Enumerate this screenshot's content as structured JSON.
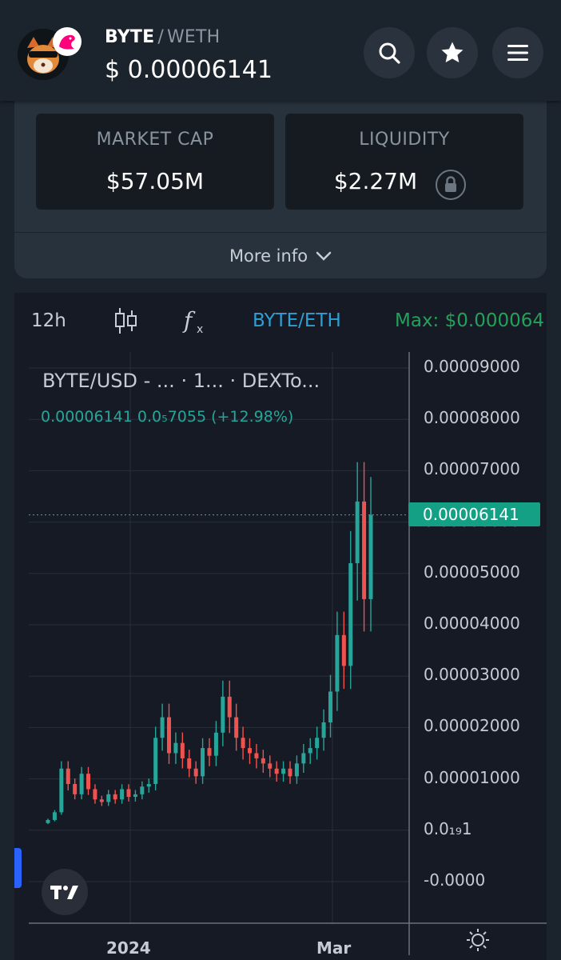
{
  "header": {
    "base_token": "BYTE",
    "separator": "/",
    "quote_token": "WETH",
    "price": "$  0.00006141",
    "icons": [
      "search-icon",
      "star-icon",
      "menu-icon"
    ]
  },
  "stats": {
    "market_cap_label": "MARKET CAP",
    "market_cap_value": "$57.05M",
    "liquidity_label": "LIQUIDITY",
    "liquidity_value": "$2.27M",
    "more_info_label": "More info"
  },
  "chart_toolbar": {
    "interval": "12h",
    "pair_label": "BYTE/ETH",
    "max_label": "Max: $0.000064"
  },
  "chart": {
    "title": "BYTE/USD - ...   · 1...   · DEXTo...",
    "ohlc_line": "0.00006141  0.0₅7055 (+12.98%)",
    "last_price_tag": "0.00006141",
    "colors": {
      "up": "#26a69a",
      "down": "#ef5350",
      "accent": "#2962ff"
    }
  },
  "chart_data": {
    "type": "candlestick",
    "y_tick_labels": [
      "0.00009000",
      "0.00008000",
      "0.00007000",
      "0.00006000",
      "0.00005000",
      "0.00004000",
      "0.00003000",
      "0.00002000",
      "0.00001000",
      "0.0₁₉1",
      "-0.0000"
    ],
    "x_tick_labels": [
      "2024",
      "Mar"
    ],
    "ylim": [
      0,
      9e-05
    ],
    "last_price": 6.141e-05,
    "change": "+12.98%",
    "closes": [
      2e-06,
      3.5e-06,
      1.2e-05,
      9e-06,
      7e-06,
      1.1e-05,
      8e-06,
      6e-06,
      5.5e-06,
      7e-06,
      6e-06,
      8e-06,
      6.5e-06,
      7e-06,
      8.5e-06,
      9e-06,
      1.8e-05,
      2.2e-05,
      1.5e-05,
      1.7e-05,
      1.4e-05,
      1.2e-05,
      1.05e-05,
      1.6e-05,
      1.45e-05,
      1.9e-05,
      2.6e-05,
      2.2e-05,
      1.8e-05,
      1.6e-05,
      1.5e-05,
      1.4e-05,
      1.3e-05,
      1.2e-05,
      1.1e-05,
      1.2e-05,
      1.05e-05,
      1.3e-05,
      1.5e-05,
      1.6e-05,
      1.8e-05,
      2.1e-05,
      2.7e-05,
      3.8e-05,
      3.2e-05,
      5.2e-05,
      6.4e-05,
      4.5e-05,
      6.141e-05
    ]
  }
}
